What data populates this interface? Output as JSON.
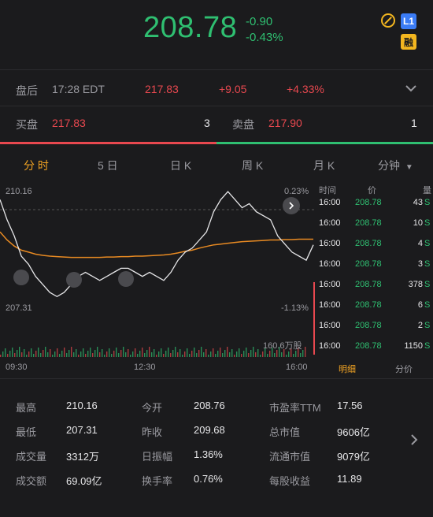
{
  "header": {
    "price": "208.78",
    "change": "-0.90",
    "change_pct": "-0.43%",
    "badge_l1": "L1",
    "badge_rong": "融"
  },
  "after_hours": {
    "label": "盘后",
    "time": "17:28 EDT",
    "price": "217.83",
    "change": "+9.05",
    "change_pct": "+4.33%"
  },
  "quote": {
    "bid_label": "买盘",
    "bid_price": "217.83",
    "bid_size": "3",
    "ask_label": "卖盘",
    "ask_price": "217.90",
    "ask_size": "1"
  },
  "tabs": [
    "分 时",
    "5 日",
    "日 K",
    "周 K",
    "月 K",
    "分钟"
  ],
  "chart": {
    "high_label": "210.16",
    "high_pct": "0.23%",
    "low_label": "207.31",
    "low_pct": "-1.13%",
    "volume_label": "160.6万股",
    "time_labels": [
      "09:30",
      "12:30",
      "16:00"
    ]
  },
  "chart_data": {
    "type": "line",
    "title": "",
    "x_start": "09:30",
    "x_end": "16:00",
    "ylim": [
      207.31,
      210.16
    ],
    "series": [
      {
        "values": [
          209.9,
          209.4,
          209.0,
          208.5,
          208.3,
          208.0,
          207.8,
          207.6,
          207.5,
          207.6,
          207.8,
          208.0,
          208.1,
          208.0,
          207.9,
          208.0,
          208.1,
          208.2,
          208.2,
          208.1,
          208.0,
          208.1,
          208.0,
          207.9,
          208.1,
          208.4,
          208.6,
          208.7,
          208.9,
          209.1,
          209.6,
          209.9,
          210.1,
          209.9,
          209.7,
          209.8,
          209.6,
          209.5,
          209.4,
          209.0,
          208.8,
          208.6,
          208.5,
          208.4,
          208.78
        ]
      },
      {
        "values": [
          209.1,
          208.9,
          208.75,
          208.65,
          208.6,
          208.55,
          208.52,
          208.5,
          208.49,
          208.48,
          208.47,
          208.47,
          208.47,
          208.47,
          208.47,
          208.48,
          208.48,
          208.49,
          208.49,
          208.5,
          208.5,
          208.51,
          208.52,
          208.53,
          208.55,
          208.58,
          208.62,
          208.65,
          208.7,
          208.74,
          208.78,
          208.8,
          208.82,
          208.84,
          208.86,
          208.87,
          208.88,
          208.89,
          208.9,
          208.9,
          208.91,
          208.91,
          208.92,
          208.92,
          208.92
        ]
      }
    ]
  },
  "ticker": {
    "headers": [
      "时间",
      "价",
      "量"
    ],
    "rows": [
      {
        "time": "16:00",
        "price": "208.78",
        "vol": "43",
        "flag": "S"
      },
      {
        "time": "16:00",
        "price": "208.78",
        "vol": "10",
        "flag": "S"
      },
      {
        "time": "16:00",
        "price": "208.78",
        "vol": "4",
        "flag": "S"
      },
      {
        "time": "16:00",
        "price": "208.78",
        "vol": "3",
        "flag": "S"
      },
      {
        "time": "16:00",
        "price": "208.78",
        "vol": "378",
        "flag": "S"
      },
      {
        "time": "16:00",
        "price": "208.78",
        "vol": "6",
        "flag": "S"
      },
      {
        "time": "16:00",
        "price": "208.78",
        "vol": "2",
        "flag": "S"
      },
      {
        "time": "16:00",
        "price": "208.78",
        "vol": "1150",
        "flag": "S"
      }
    ],
    "tab_detail": "明细",
    "tab_price": "分价"
  },
  "stats": [
    [
      {
        "label": "最高",
        "value": "210.16"
      },
      {
        "label": "今开",
        "value": "208.76"
      },
      {
        "label": "市盈率TTM",
        "value": "17.56"
      }
    ],
    [
      {
        "label": "最低",
        "value": "207.31"
      },
      {
        "label": "昨收",
        "value": "209.68"
      },
      {
        "label": "总市值",
        "value": "9606亿"
      }
    ],
    [
      {
        "label": "成交量",
        "value": "3312万"
      },
      {
        "label": "日振幅",
        "value": "1.36%"
      },
      {
        "label": "流通市值",
        "value": "9079亿"
      }
    ],
    [
      {
        "label": "成交额",
        "value": "69.09亿"
      },
      {
        "label": "换手率",
        "value": "0.76%"
      },
      {
        "label": "每股收益",
        "value": "11.89"
      }
    ]
  ],
  "colors": {
    "down": "#2fbf71",
    "up": "#e8484f",
    "accent": "#f3a423",
    "background": "#1b1b1d"
  }
}
